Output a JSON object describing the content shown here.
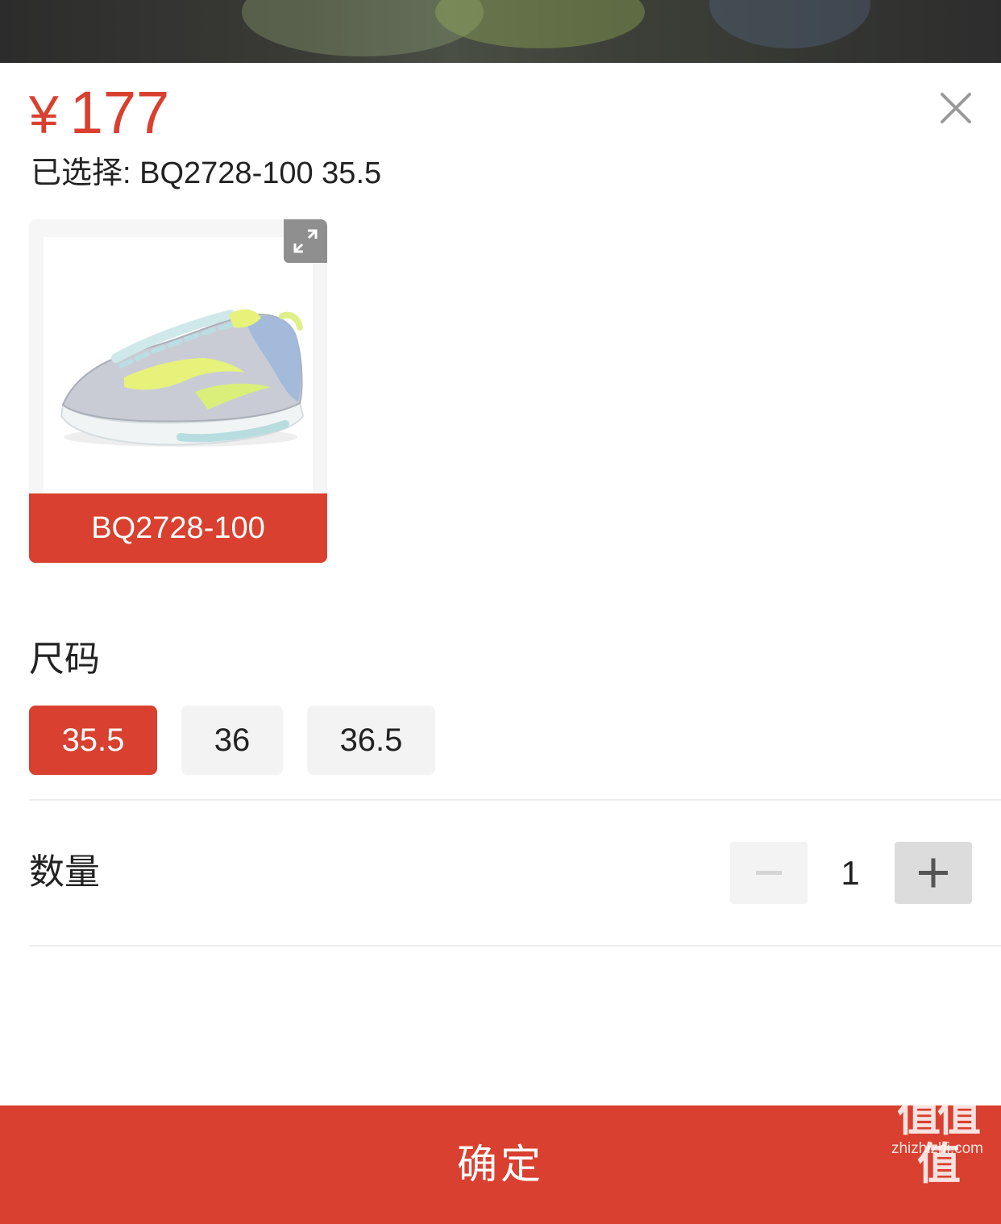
{
  "sheet": {
    "price": {
      "currency": "¥",
      "amount": "177"
    },
    "selected": {
      "prefix": "已选择:",
      "value": "BQ2728-100 35.5"
    },
    "variant": {
      "label": "BQ2728-100",
      "selected": true,
      "image": "shoe-photo"
    },
    "size": {
      "title": "尺码",
      "options": [
        {
          "label": "35.5",
          "selected": true
        },
        {
          "label": "36",
          "selected": false
        },
        {
          "label": "36.5",
          "selected": false
        }
      ]
    },
    "quantity": {
      "title": "数量",
      "value": "1",
      "minus_icon": "minus-icon",
      "plus_icon": "plus-icon"
    },
    "confirm_label": "确定"
  },
  "watermark": {
    "logo_text": "值值值",
    "url": "zhizhizhi.com"
  },
  "colors": {
    "accent": "#d9402f",
    "option_bg": "#f3f3f3",
    "text": "#222222"
  }
}
